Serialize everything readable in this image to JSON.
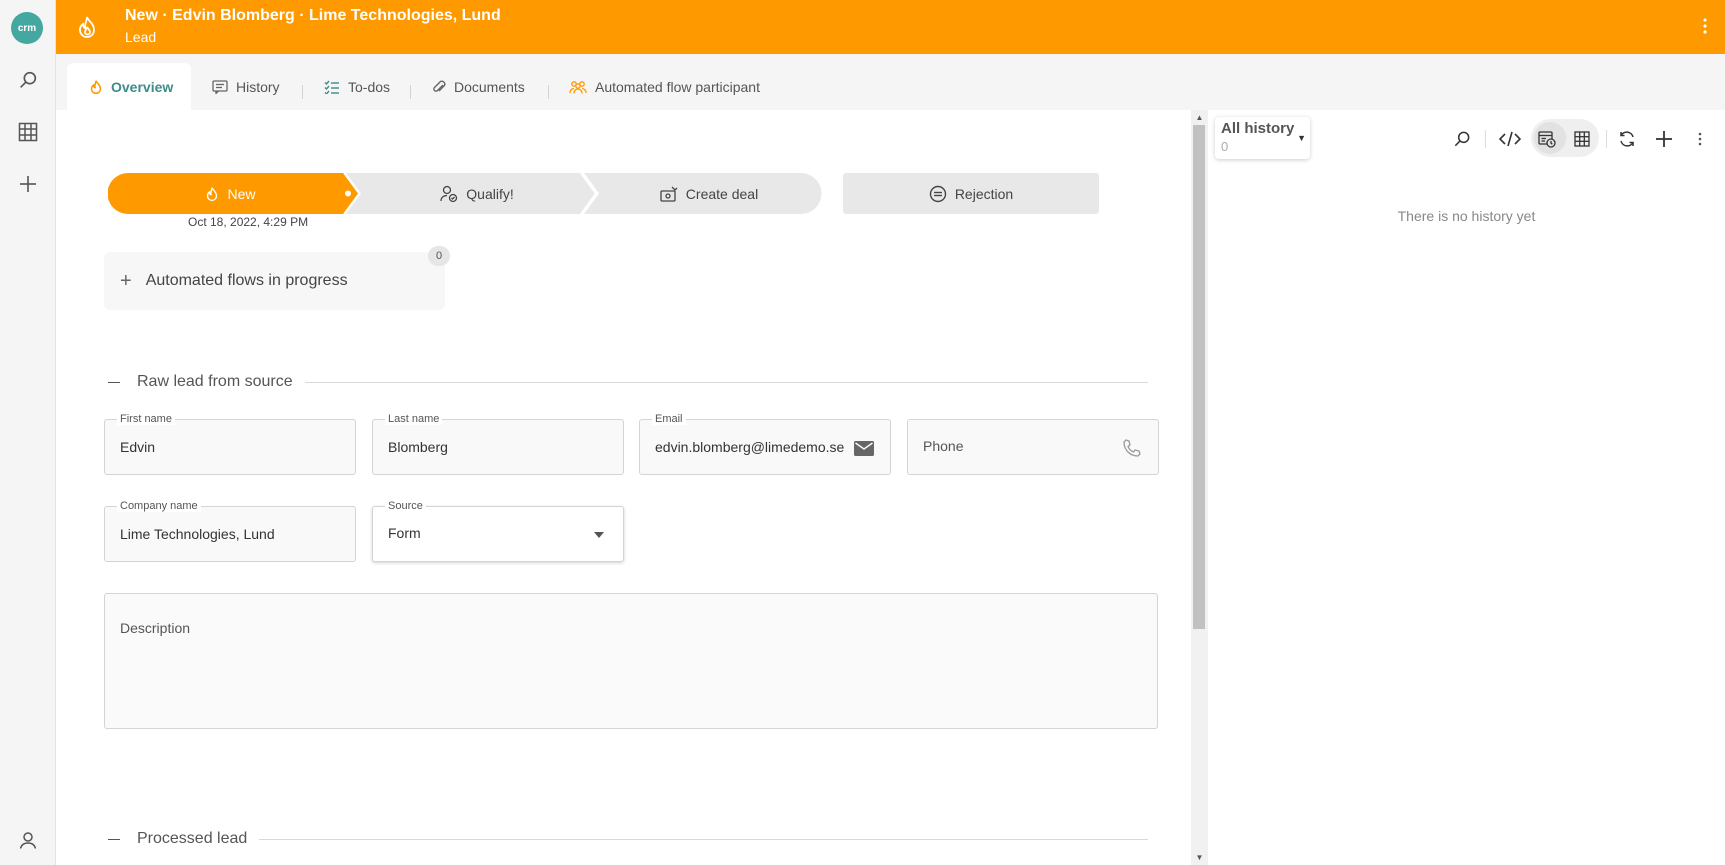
{
  "rail": {
    "logo_text": "crm"
  },
  "header": {
    "title": "New · Edvin Blomberg · Lime Technologies, Lund",
    "subtitle": "Lead"
  },
  "tabs": [
    {
      "label": "Overview"
    },
    {
      "label": "History"
    },
    {
      "label": "To-dos"
    },
    {
      "label": "Documents"
    },
    {
      "label": "Automated flow participant"
    }
  ],
  "stepper": {
    "steps": [
      {
        "label": "New"
      },
      {
        "label": "Qualify!"
      },
      {
        "label": "Create deal"
      }
    ],
    "rejection_label": "Rejection",
    "date": "Oct 18, 2022, 4:29 PM"
  },
  "flows": {
    "label": "Automated flows in progress",
    "count": "0"
  },
  "sections": {
    "raw": "Raw lead from source",
    "processed": "Processed lead"
  },
  "fields": {
    "first_name": {
      "label": "First name",
      "value": "Edvin"
    },
    "last_name": {
      "label": "Last name",
      "value": "Blomberg"
    },
    "email": {
      "label": "Email",
      "value": "edvin.blomberg@limedemo.se"
    },
    "phone": {
      "placeholder": "Phone"
    },
    "company": {
      "label": "Company name",
      "value": "Lime Technologies, Lund"
    },
    "source": {
      "label": "Source",
      "value": "Form"
    },
    "description": {
      "placeholder": "Description"
    }
  },
  "history": {
    "filter_label": "All history",
    "filter_count": "0",
    "empty_text": "There is no history yet"
  },
  "colors": {
    "accent": "#fe9900",
    "teal": "#3d8c86",
    "step_bg": "#e8e8e8"
  }
}
